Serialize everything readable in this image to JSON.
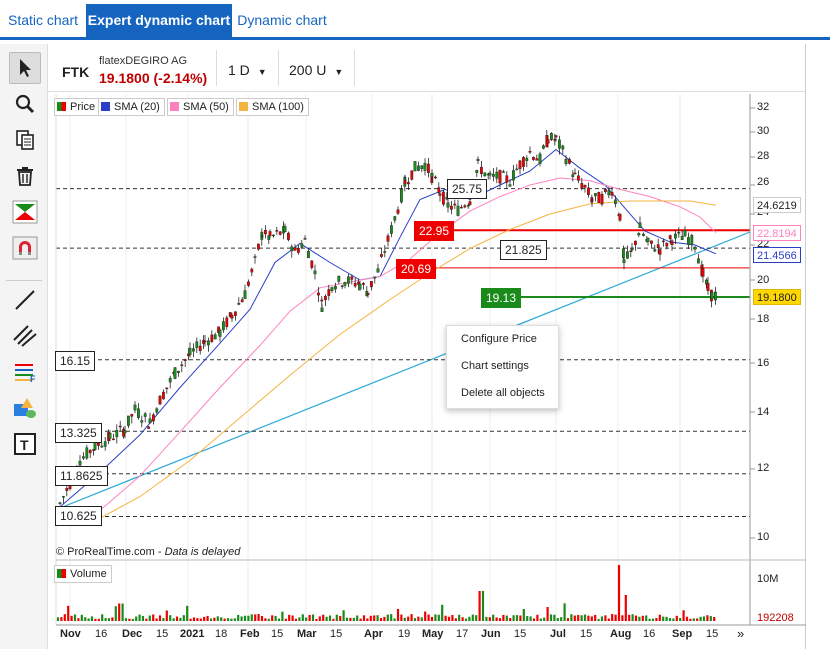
{
  "tabs": [
    {
      "label": "Static chart",
      "active": false
    },
    {
      "label": "Expert dynamic chart",
      "active": true
    },
    {
      "label": "Dynamic chart",
      "active": false
    }
  ],
  "header": {
    "symbol": "FTK",
    "name": "flatexDEGIRO AG",
    "price_change": "19.1800 (-2.14%)",
    "interval": "1 D",
    "units": "200 U"
  },
  "tools": [
    "cursor-icon",
    "zoom-icon",
    "copy-icon",
    "trash-icon",
    "flag-icon",
    "magnet-icon",
    "line-icon",
    "channel-icon",
    "fibonacci-icon",
    "shapes-icon",
    "text-icon"
  ],
  "legend": [
    {
      "label": "Price",
      "color": "#1a8a1a"
    },
    {
      "label": "SMA (20)",
      "color": "#2a3fc7"
    },
    {
      "label": "SMA (50)",
      "color": "#ff80c0"
    },
    {
      "label": "SMA (100)",
      "color": "#f5b342"
    }
  ],
  "price_axis": {
    "ticks": [
      "32",
      "30",
      "28",
      "26",
      "24",
      "22",
      "20",
      "18",
      "16",
      "14",
      "12",
      "10"
    ],
    "markers": [
      {
        "label": "24.6219",
        "bg": "#ffffff",
        "fg": "#222222",
        "border": "#cccccc"
      },
      {
        "label": "22.8194",
        "bg": "#ffffff",
        "fg": "#ff80c0",
        "border": "#ff80c0"
      },
      {
        "label": "21.4566",
        "bg": "#ffffff",
        "fg": "#2a3fc7",
        "border": "#2a3fc7"
      },
      {
        "label": "19.1800",
        "bg": "#ffd700",
        "fg": "#222222",
        "border": "#e0b800"
      }
    ]
  },
  "hlines": [
    {
      "label": "25.75",
      "style": "dashed"
    },
    {
      "label": "22.95",
      "style": "red"
    },
    {
      "label": "21.825",
      "style": "dashed"
    },
    {
      "label": "20.69",
      "style": "red"
    },
    {
      "label": "19.13",
      "style": "green"
    },
    {
      "label": "16.15",
      "style": "dashed"
    },
    {
      "label": "13.325",
      "style": "dashed"
    },
    {
      "label": "11.8625",
      "style": "dashed"
    },
    {
      "label": "10.625",
      "style": "dashed"
    }
  ],
  "context_menu": [
    "Configure Price",
    "Chart settings",
    "Delete all objects"
  ],
  "copyright": "© ProRealTime.com",
  "data_note": "Data is delayed",
  "volume": {
    "label": "Volume",
    "max_tick": "10M",
    "last": "192208"
  },
  "time_axis": [
    "Nov",
    "16",
    "Dec",
    "15",
    "2021",
    "18",
    "Feb",
    "15",
    "Mar",
    "15",
    "Apr",
    "19",
    "May",
    "17",
    "Jun",
    "15",
    "Jul",
    "15",
    "Aug",
    "16",
    "Sep",
    "15"
  ],
  "scroll_label": "»"
}
